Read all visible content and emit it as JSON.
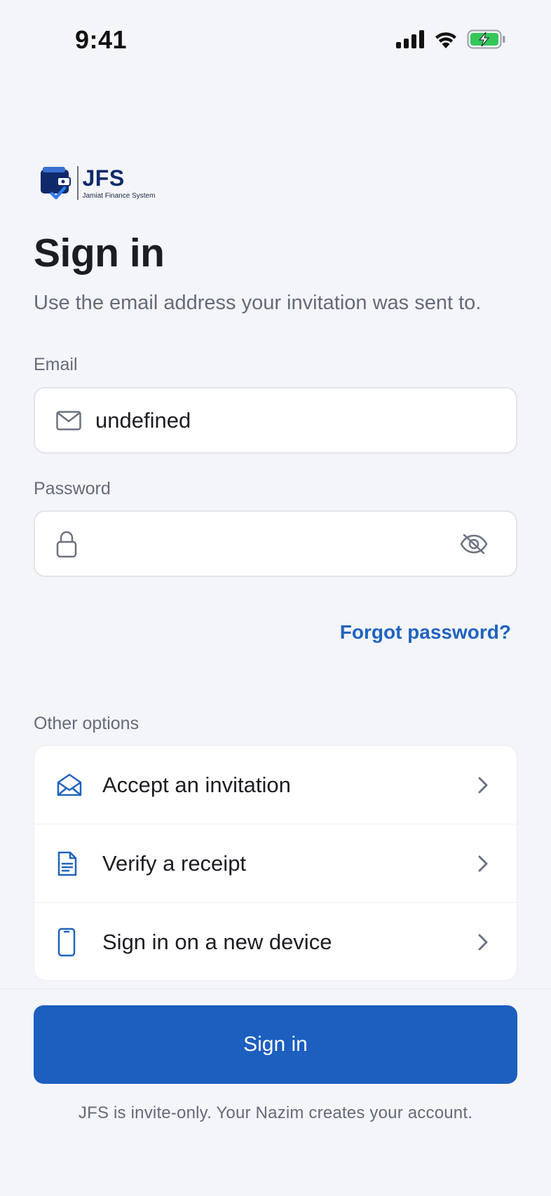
{
  "status_bar": {
    "time": "9:41",
    "icons": [
      "cellular-signal-icon",
      "wifi-icon",
      "battery-charging-icon"
    ]
  },
  "logo": {
    "title": "JFS",
    "subtitle": "Jamiat Finance System"
  },
  "header": {
    "title": "Sign in",
    "subtitle": "Use the email address your invitation was sent to."
  },
  "email": {
    "label": "Email",
    "value": "undefined",
    "icon": "mail-icon"
  },
  "password": {
    "label": "Password",
    "value": "",
    "icon": "lock-icon",
    "toggle_icon": "eye-off-icon"
  },
  "forgot_password": "Forgot password?",
  "other_options": {
    "label": "Other options",
    "items": [
      {
        "label": "Accept an invitation",
        "icon": "envelope-open-icon"
      },
      {
        "label": "Verify a receipt",
        "icon": "document-icon"
      },
      {
        "label": "Sign in on a new device",
        "icon": "phone-icon"
      }
    ]
  },
  "sign_in_button": "Sign in",
  "footer_note": "JFS is invite-only. Your Nazim creates your account.",
  "colors": {
    "accent": "#1c5fbf",
    "link": "#1f63c0",
    "background": "#f4f5f9",
    "battery": "#34c759"
  }
}
